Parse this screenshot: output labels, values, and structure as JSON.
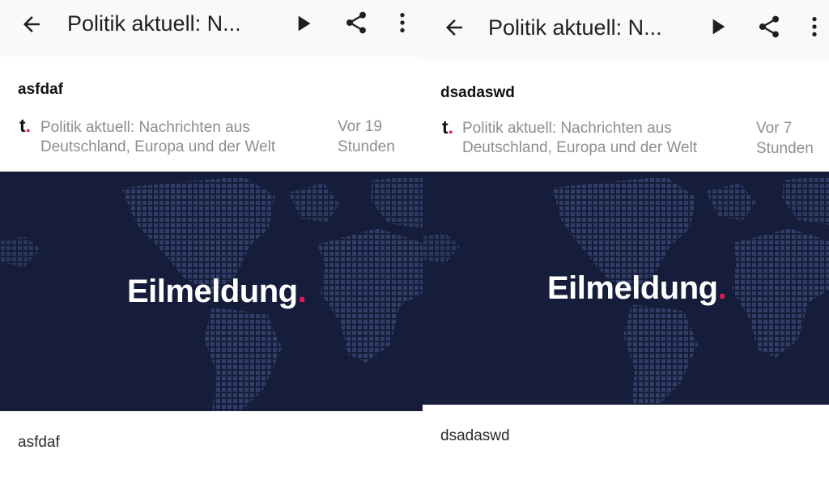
{
  "colors": {
    "appbar_bg": "#fbf8fb",
    "media_bg": "#151d3a",
    "accent": "#e3185b",
    "muted_text": "#8e8e8e"
  },
  "icons": {
    "back": "arrow-left",
    "play": "play-triangle",
    "share": "share-nodes",
    "more": "vertical-ellipsis"
  },
  "screens": [
    {
      "appbar": {
        "title": "Politik aktuell: N..."
      },
      "article": {
        "headline": "asfdaf",
        "source_logo": "t",
        "source_logo_dot": ".",
        "source_name": "Politik aktuell: Nachrichten aus Deutschland, Europa und der Welt",
        "timestamp": "Vor 19 Stunden",
        "image_brand": "Eilmeldung",
        "image_brand_dot": ".",
        "body": "asfdaf"
      }
    },
    {
      "appbar": {
        "title": "Politik aktuell: N..."
      },
      "article": {
        "headline": "dsadaswd",
        "source_logo": "t",
        "source_logo_dot": ".",
        "source_name": "Politik aktuell: Nachrichten aus Deutschland, Europa und der Welt",
        "timestamp": "Vor 7 Stunden",
        "image_brand": "Eilmeldung",
        "image_brand_dot": ".",
        "body": "dsadaswd"
      }
    }
  ]
}
